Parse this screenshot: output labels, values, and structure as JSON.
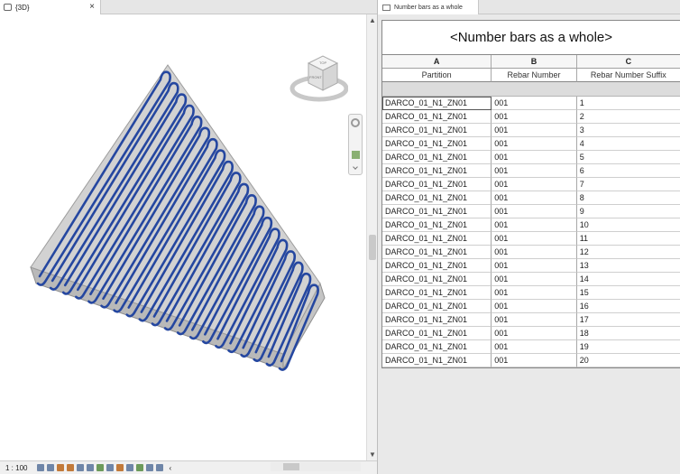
{
  "left_view": {
    "tab_label": "{3D}",
    "close_glyph": "×",
    "view_cube_top": "TOP",
    "view_cube_front": "FRONT",
    "scale": "1 : 100"
  },
  "schedule": {
    "tab_label": "Number bars as a whole",
    "title": "<Number bars as a whole>",
    "column_letters": [
      "A",
      "B",
      "C"
    ],
    "column_headers": [
      "Partition",
      "Rebar Number",
      "Rebar Number Suffix"
    ],
    "rows": [
      [
        "DARCO_01_N1_ZN01",
        "001",
        "1"
      ],
      [
        "DARCO_01_N1_ZN01",
        "001",
        "2"
      ],
      [
        "DARCO_01_N1_ZN01",
        "001",
        "3"
      ],
      [
        "DARCO_01_N1_ZN01",
        "001",
        "4"
      ],
      [
        "DARCO_01_N1_ZN01",
        "001",
        "5"
      ],
      [
        "DARCO_01_N1_ZN01",
        "001",
        "6"
      ],
      [
        "DARCO_01_N1_ZN01",
        "001",
        "7"
      ],
      [
        "DARCO_01_N1_ZN01",
        "001",
        "8"
      ],
      [
        "DARCO_01_N1_ZN01",
        "001",
        "9"
      ],
      [
        "DARCO_01_N1_ZN01",
        "001",
        "10"
      ],
      [
        "DARCO_01_N1_ZN01",
        "001",
        "11"
      ],
      [
        "DARCO_01_N1_ZN01",
        "001",
        "12"
      ],
      [
        "DARCO_01_N1_ZN01",
        "001",
        "13"
      ],
      [
        "DARCO_01_N1_ZN01",
        "001",
        "14"
      ],
      [
        "DARCO_01_N1_ZN01",
        "001",
        "15"
      ],
      [
        "DARCO_01_N1_ZN01",
        "001",
        "16"
      ],
      [
        "DARCO_01_N1_ZN01",
        "001",
        "17"
      ],
      [
        "DARCO_01_N1_ZN01",
        "001",
        "18"
      ],
      [
        "DARCO_01_N1_ZN01",
        "001",
        "19"
      ],
      [
        "DARCO_01_N1_ZN01",
        "001",
        "20"
      ]
    ]
  },
  "colors": {
    "rebar": "#2547a0",
    "slab": "#cfcfcf",
    "slab_edge": "#9c9c9c"
  }
}
